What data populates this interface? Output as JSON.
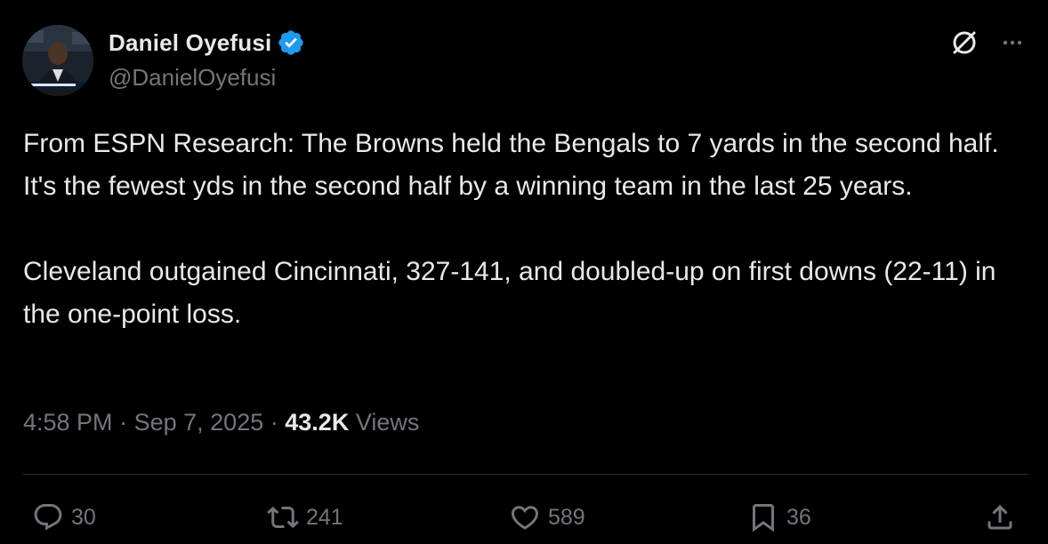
{
  "author": {
    "display_name": "Daniel Oyefusi",
    "handle": "@DanielOyefusi",
    "verified": true
  },
  "tweet": {
    "paragraphs": [
      "From ESPN Research: The Browns held the Bengals to 7 yards in the second half. It's the fewest yds in the second half by a winning team in the last 25 years.",
      "Cleveland outgained Cincinnati, 327-141, and doubled-up on first downs (22-11) in the one-point loss."
    ]
  },
  "meta": {
    "time": "4:58 PM",
    "separator": "·",
    "date": "Sep 7, 2025",
    "views_count": "43.2K",
    "views_label": "Views"
  },
  "actions": {
    "replies": "30",
    "retweets": "241",
    "likes": "589",
    "bookmarks": "36"
  },
  "icons": {
    "verified": "verified-badge-icon",
    "grok": "grok-icon",
    "more": "more-icon",
    "reply": "reply-icon",
    "retweet": "retweet-icon",
    "like": "heart-icon",
    "bookmark": "bookmark-icon",
    "share": "share-icon"
  },
  "colors": {
    "background": "#000000",
    "text_primary": "#e7e9ea",
    "text_secondary": "#71767b",
    "verified_blue": "#1d9bf0",
    "divider": "#2f3336"
  }
}
